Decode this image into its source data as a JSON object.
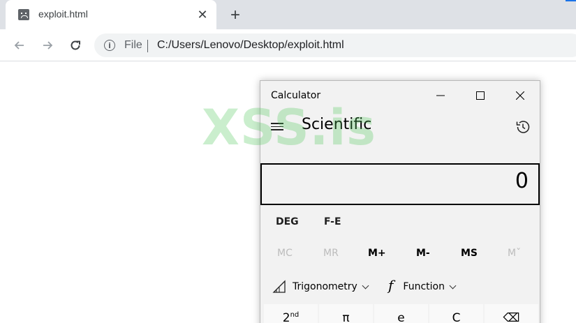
{
  "browser": {
    "tab": {
      "title": "exploit.html",
      "close_glyph": "✕",
      "favicon": "sad-page-icon"
    },
    "new_tab_glyph": "+",
    "address": {
      "scheme_label": "File",
      "url": "C:/Users/Lenovo/Desktop/exploit.html",
      "info_glyph": "i"
    }
  },
  "watermark": {
    "text": "XSS.is"
  },
  "calculator": {
    "window_title": "Calculator",
    "mode_title": "Scientific",
    "display_value": "0",
    "angle_unit": "DEG",
    "notation": "F-E",
    "memory_buttons": [
      {
        "label": "MC",
        "enabled": false
      },
      {
        "label": "MR",
        "enabled": false
      },
      {
        "label": "M+",
        "enabled": true
      },
      {
        "label": "M-",
        "enabled": true
      },
      {
        "label": "MS",
        "enabled": true
      },
      {
        "label": "Mˇ",
        "enabled": false
      }
    ],
    "dropdowns": [
      {
        "label": "Trigonometry",
        "icon": "triangle-ruler-icon"
      },
      {
        "label": "Function",
        "icon": "function-f-icon",
        "glyph": "f"
      }
    ],
    "keys": [
      {
        "label": "2",
        "sup": "nd"
      },
      {
        "label": "π"
      },
      {
        "label": "e"
      },
      {
        "label": "C"
      },
      {
        "label": "⌫"
      }
    ]
  }
}
